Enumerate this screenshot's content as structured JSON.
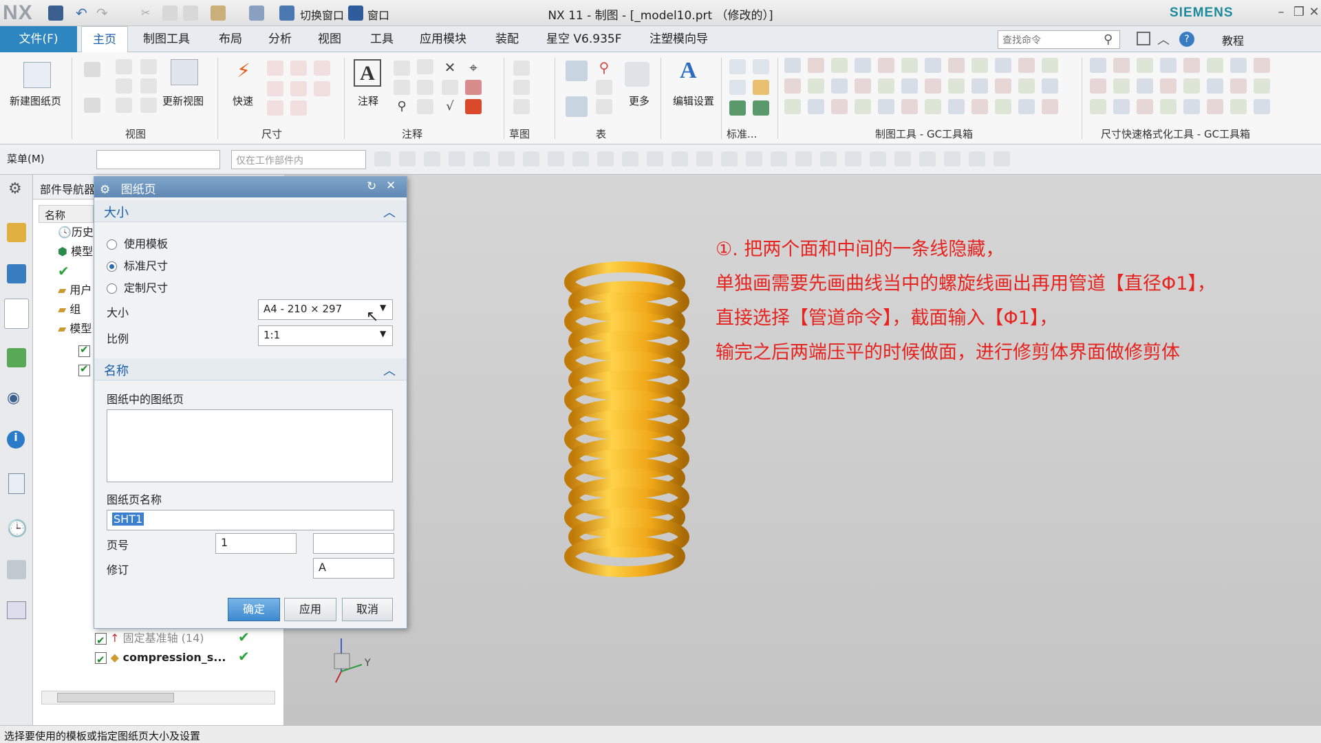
{
  "titlebar": {
    "logo": "NX",
    "switch_window": "切换窗口",
    "window_menu": "窗口",
    "title": "NX 11 - 制图 - [_model10.prt （修改的）]",
    "brand": "SIEMENS"
  },
  "menubar": {
    "file": "文件(F)",
    "tabs": [
      "主页",
      "制图工具",
      "布局",
      "分析",
      "视图",
      "工具",
      "应用模块",
      "装配",
      "星空 V6.935F",
      "注塑模向导"
    ],
    "active_tab": "主页",
    "search_placeholder": "查找命令",
    "tutorial": "教程"
  },
  "ribbon": {
    "new_sheet": "新建图纸页",
    "update_views": "更新视图",
    "quick": "快速",
    "annotation": "注释",
    "more": "更多",
    "edit_settings": "编辑设置",
    "groups": {
      "view": "视图",
      "dimension": "尺寸",
      "annotation": "注释",
      "sketch": "草图",
      "table": "表",
      "standard": "标准...",
      "gc_drafting": "制图工具 - GC工具箱",
      "gc_dim": "尺寸快速格式化工具 - GC工具箱"
    }
  },
  "toolbar2": {
    "menu": "菜单(M)",
    "filter_placeholder": "",
    "scope": "仅在工作部件内"
  },
  "navigator": {
    "title": "部件导航器",
    "column_name": "名称",
    "rows": [
      "历史",
      "模型",
      "",
      "用户",
      "组",
      "模型"
    ],
    "bottom_rows": [
      {
        "label": "固定基准轴 (14)"
      },
      {
        "label": "compression_s..."
      }
    ]
  },
  "dialog": {
    "title": "图纸页",
    "size_section": "大小",
    "options": [
      "使用模板",
      "标准尺寸",
      "定制尺寸"
    ],
    "selected_option": 1,
    "size_label": "大小",
    "size_value": "A4 - 210 × 297",
    "scale_label": "比例",
    "scale_value": "1:1",
    "name_section": "名称",
    "sheets_in_drawing": "图纸中的图纸页",
    "sheet_name_label": "图纸页名称",
    "sheet_name_value": "SHT1",
    "page_no_label": "页号",
    "page_no_value": "1",
    "page_no_extra": "",
    "revision_label": "修订",
    "revision_value": "A",
    "ok": "确定",
    "apply": "应用",
    "cancel": "取消"
  },
  "annotation_note": [
    "①. 把两个面和中间的一条线隐藏，",
    "单独画需要先画曲线当中的螺旋线画出再用管道【直径Φ1】，",
    "直接选择【管道命令】，截面输入【Φ1】，",
    "输完之后两端压平的时候做面，进行修剪体界面做修剪体"
  ],
  "triad": {
    "y_label": "Y"
  },
  "status": "选择要使用的模板或指定图纸页大小及设置",
  "colors": {
    "accent": "#2e86c1",
    "spring": "#f0a818",
    "note_red": "#e5231f"
  }
}
